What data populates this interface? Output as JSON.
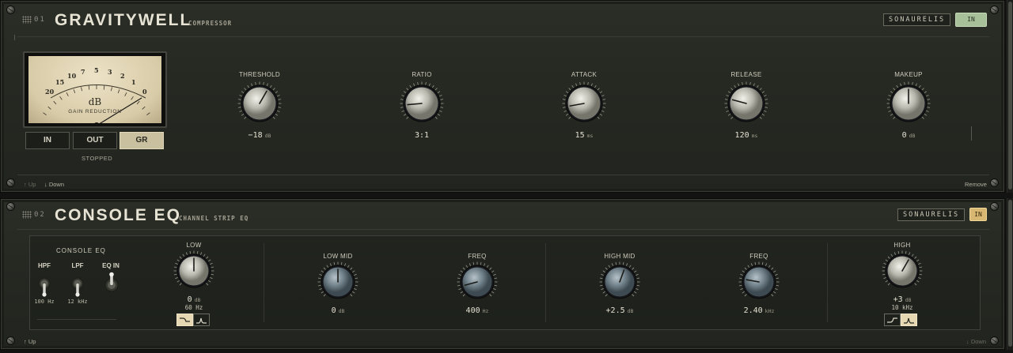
{
  "compressor": {
    "slot": "01",
    "name": "GRAVITYWELL",
    "subtitle": "COMPRESSOR",
    "brand": "SONAURELIS",
    "in_label": "IN",
    "meter": {
      "scale": [
        "20",
        "15",
        "10",
        "7",
        "5",
        "3",
        "2",
        "1",
        "0"
      ],
      "unit": "dB",
      "caption": "GAIN REDUCTION",
      "modes": [
        "IN",
        "OUT",
        "GR"
      ],
      "active_mode": "GR",
      "status": "STOPPED"
    },
    "knobs": [
      {
        "label": "THRESHOLD",
        "value": "−18",
        "unit": "dB",
        "angle": 30
      },
      {
        "label": "RATIO",
        "value": "3:1",
        "unit": "",
        "angle": -95
      },
      {
        "label": "ATTACK",
        "value": "15",
        "unit": "ms",
        "angle": -100
      },
      {
        "label": "RELEASE",
        "value": "120",
        "unit": "ms",
        "angle": -75
      },
      {
        "label": "MAKEUP",
        "value": "0",
        "unit": "dB",
        "angle": 0
      }
    ],
    "nav": {
      "up": "↑ Up",
      "down": "↓ Down",
      "remove": "Remove"
    }
  },
  "eq": {
    "slot": "02",
    "name": "CONSOLE EQ",
    "subtitle": "CHANNEL STRIP EQ",
    "brand": "SONAURELIS",
    "in_label": "IN",
    "panel_title": "CONSOLE EQ",
    "switches": [
      {
        "label": "HPF",
        "value": "100 Hz"
      },
      {
        "label": "LPF",
        "value": "12 kHz"
      },
      {
        "label": "EQ IN",
        "value": ""
      }
    ],
    "bands": [
      {
        "label": "LOW",
        "value": "0",
        "unit": "dB",
        "sub": "60 Hz",
        "angle": 0,
        "style": "light"
      },
      {
        "label": "LOW MID",
        "value": "0",
        "unit": "dB",
        "sub": "",
        "angle": 0,
        "style": "blue"
      },
      {
        "label": "FREQ",
        "value": "400",
        "unit": "Hz",
        "sub": "",
        "angle": -105,
        "style": "blue"
      },
      {
        "label": "HIGH MID",
        "value": "+2.5",
        "unit": "dB",
        "sub": "",
        "angle": 20,
        "style": "blue"
      },
      {
        "label": "FREQ",
        "value": "2.40",
        "unit": "kHz",
        "sub": "",
        "angle": -80,
        "style": "blue"
      },
      {
        "label": "HIGH",
        "value": "+3",
        "unit": "dB",
        "sub": "10 kHz",
        "angle": 30,
        "style": "light"
      }
    ],
    "nav": {
      "up": "↑ Up",
      "down": "↓ Down"
    }
  },
  "colors": {
    "accent_green": "#a8c09a",
    "accent_gold": "#d8b772",
    "meter_face": "#e2d6b6"
  }
}
